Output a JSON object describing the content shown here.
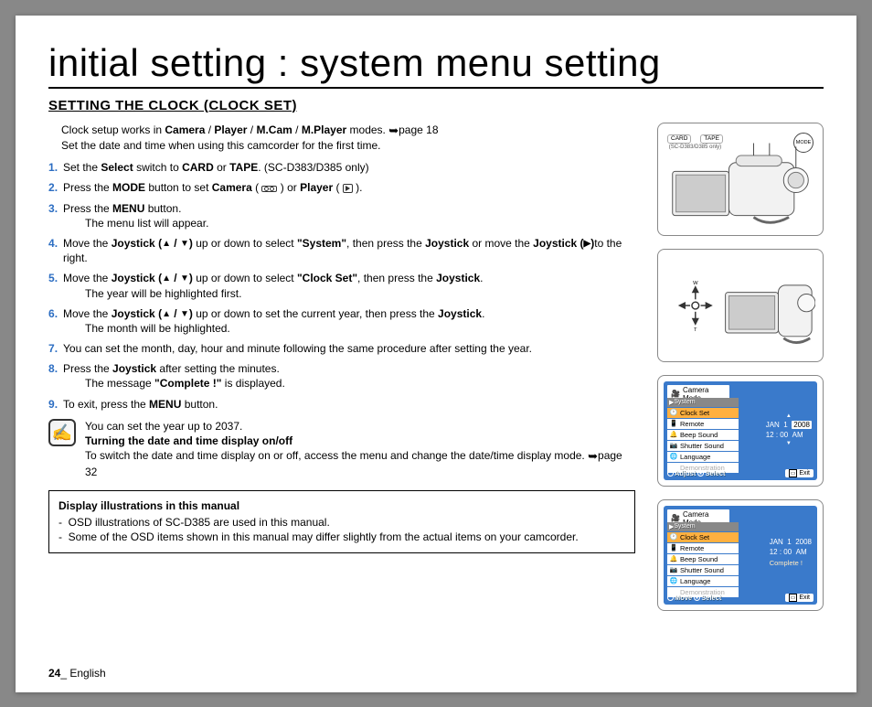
{
  "title": "initial setting : system menu setting",
  "subtitle": "SETTING THE CLOCK (CLOCK SET)",
  "intro_prefix": "Clock setup works in ",
  "intro_modes": {
    "m1": "Camera",
    "slash": " / ",
    "m2": "Player",
    "m3": "M.Cam",
    "m4": "M.Player"
  },
  "intro_suffix": " modes. ",
  "intro_pageref": "page 18",
  "intro_line2": "Set the date and time when using this camcorder for the first time.",
  "steps": {
    "s1a": "Set the ",
    "s1b": "Select",
    "s1c": " switch to ",
    "s1d": "CARD",
    "s1e": " or ",
    "s1f": "TAPE",
    "s1g": ". (SC-D383/D385 only)",
    "s2a": "Press the ",
    "s2b": "MODE",
    "s2c": " button to set ",
    "s2d": "Camera",
    "s2e": " ( ",
    "s2f": " ) or ",
    "s2g": "Player",
    "s2h": " ( ",
    "s2i": " ).",
    "s3a": "Press the ",
    "s3b": "MENU",
    "s3c": " button.",
    "s3sub": "The menu list will appear.",
    "s4a": "Move the ",
    "s4b": "Joystick (",
    "s4c": " / ",
    "s4d": ")",
    "s4e": " up or down to select ",
    "s4f": "\"System\"",
    "s4g": ", then press the ",
    "s4h": "Joystick",
    "s4i": " or move the ",
    "s4j": "Joystick (",
    "s4k": ")",
    "s4l": "to the right.",
    "s5a": "Move the ",
    "s5b": "Joystick (",
    "s5c": " / ",
    "s5d": ")",
    "s5e": " up or down to select ",
    "s5f": "\"Clock Set\"",
    "s5g": ", then press the ",
    "s5h": "Joystick",
    "s5i": ".",
    "s5sub": "The year will be highlighted first.",
    "s6a": "Move the ",
    "s6b": "Joystick (",
    "s6c": " / ",
    "s6d": ")",
    "s6e": " up or down to set the current year, then press the ",
    "s6h": "Joystick",
    "s6i": ".",
    "s6sub": "The month will be highlighted.",
    "s7": "You can set the month, day, hour and minute following the same procedure after setting the year.",
    "s8a": "Press the ",
    "s8b": "Joystick",
    "s8c": " after setting the minutes.",
    "s8sub_a": "The message ",
    "s8sub_b": "\"Complete !\"",
    "s8sub_c": " is displayed.",
    "s9a": "To exit, press the ",
    "s9b": "MENU",
    "s9c": " button."
  },
  "tip": {
    "line1": "You can set the year up to 2037.",
    "line2_title": "Turning the date and time display on/off",
    "line3": "To switch the date and time display on or off, access the menu and change the date/time display mode. ",
    "pageref": "page 32"
  },
  "notebox": {
    "title": "Display illustrations in this manual",
    "l1": "OSD illustrations of SC-D385 are used in this manual.",
    "l2": "Some of the OSD items shown in this manual may differ slightly from the actual items on your camcorder."
  },
  "footer": {
    "page": "24",
    "sep": "_ ",
    "lang": "English"
  },
  "diagram1": {
    "card": "CARD",
    "tape": "TAPE",
    "mode": "MODE",
    "model": "(SC-D383/D385 only)"
  },
  "osd": {
    "mode_title": "Camera Mode",
    "system": "System",
    "items": {
      "clock": "Clock Set",
      "remote": "Remote",
      "beep": "Beep Sound",
      "shutter": "Shutter Sound",
      "lang": "Language",
      "demo": "Demonstration"
    },
    "date": {
      "mon": "JAN",
      "day": "1",
      "year": "2008",
      "time": "12 : 00",
      "ampm": "AM"
    },
    "footer1": {
      "adjust": "Adjust",
      "select": "Select",
      "exit": "Exit"
    },
    "footer2": {
      "move": "Move",
      "select": "Select",
      "exit": "Exit"
    },
    "complete": "Complete !"
  }
}
